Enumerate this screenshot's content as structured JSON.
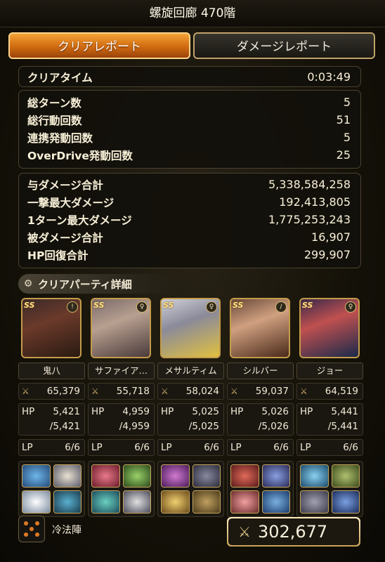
{
  "title": "螺旋回廊 470階",
  "tabs": {
    "clear_report": "クリアレポート",
    "damage_report": "ダメージレポート"
  },
  "clear_time": {
    "label": "クリアタイム",
    "value": "0:03:49"
  },
  "counts": [
    {
      "label": "総ターン数",
      "value": "5"
    },
    {
      "label": "総行動回数",
      "value": "51"
    },
    {
      "label": "連携発動回数",
      "value": "5"
    },
    {
      "label": "OverDrive発動回数",
      "value": "25"
    }
  ],
  "damage": [
    {
      "label": "与ダメージ合計",
      "value": "5,338,584,258"
    },
    {
      "label": "一撃最大ダメージ",
      "value": "192,413,805"
    },
    {
      "label": "1ターン最大ダメージ",
      "value": "1,775,253,243"
    },
    {
      "label": "被ダメージ合計",
      "value": "16,907"
    },
    {
      "label": "HP回復合計",
      "value": "299,907"
    }
  ],
  "party_header": "クリアパーティ詳細",
  "members": [
    {
      "name": "鬼八",
      "power": "65,379",
      "hp": "5,421",
      "hp_max": "/5,421",
      "lp": "6/6",
      "weapon": "!"
    },
    {
      "name": "サファイア…",
      "power": "55,718",
      "hp": "4,959",
      "hp_max": "/4,959",
      "lp": "6/6",
      "weapon": "♀"
    },
    {
      "name": "メサルティム",
      "power": "58,024",
      "hp": "5,025",
      "hp_max": "/5,025",
      "lp": "6/6",
      "weapon": "♀"
    },
    {
      "name": "シルバー",
      "power": "59,037",
      "hp": "5,026",
      "hp_max": "/5,026",
      "lp": "6/6",
      "weapon": "/"
    },
    {
      "name": "ジョー",
      "power": "64,519",
      "hp": "5,441",
      "hp_max": "/5,441",
      "lp": "6/6",
      "weapon": "♀"
    }
  ],
  "stat_labels": {
    "hp": "HP",
    "lp": "LP",
    "ss": "SS"
  },
  "formation": "冷法陣",
  "total_power": "302,677",
  "colors": {
    "accent_orange": "#f4a236",
    "gold_border": "#c49c4a"
  }
}
